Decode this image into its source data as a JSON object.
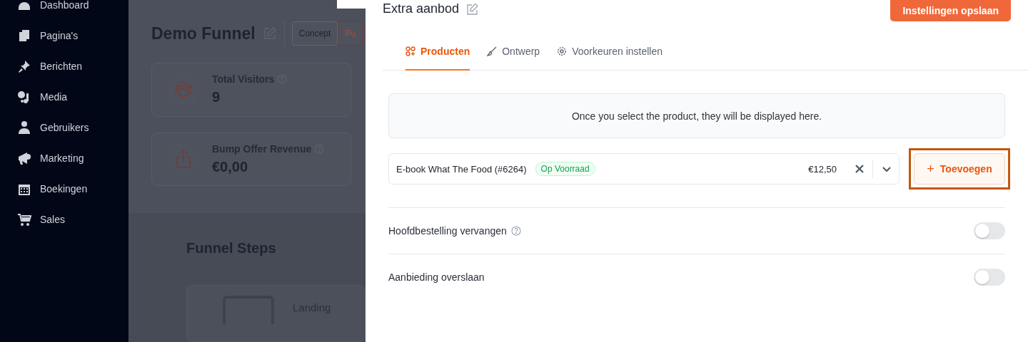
{
  "sidebar": {
    "items": [
      {
        "label": "Dashboard"
      },
      {
        "label": "Pagina's"
      },
      {
        "label": "Berichten"
      },
      {
        "label": "Media"
      },
      {
        "label": "Gebruikers"
      },
      {
        "label": "Marketing"
      },
      {
        "label": "Boekingen"
      },
      {
        "label": "Sales"
      }
    ]
  },
  "background_page": {
    "title": "Demo Funnel",
    "status_buttons": [
      {
        "label": "Concept",
        "selected": false
      },
      {
        "label": "Pu",
        "selected": true
      }
    ],
    "stats": [
      {
        "label": "Total Visitors",
        "value": "9"
      },
      {
        "label": "Bump Offer Revenue",
        "value": "€0,00"
      }
    ],
    "section_title": "Funnel Steps",
    "step_label": "Landing"
  },
  "drawer": {
    "title": "Extra aanbod",
    "save_button": "Instellingen opslaan",
    "tabs": [
      {
        "label": "Producten",
        "selected": true
      },
      {
        "label": "Ontwerp",
        "selected": false
      },
      {
        "label": "Voorkeuren instellen",
        "selected": false
      }
    ],
    "info": "Once you select the product, they will be displayed here.",
    "product": {
      "name": "E-book What The Food (#6264)",
      "badge": "Op Voorraad",
      "price": "€12,50"
    },
    "add_button": {
      "label": "Toevoegen",
      "icon": "+",
      "focused": true
    },
    "toggles": [
      {
        "label": "Hoofdbestelling vervangen",
        "help": true,
        "on": false
      },
      {
        "label": "Aanbieding overslaan",
        "help": false,
        "on": false
      }
    ]
  }
}
